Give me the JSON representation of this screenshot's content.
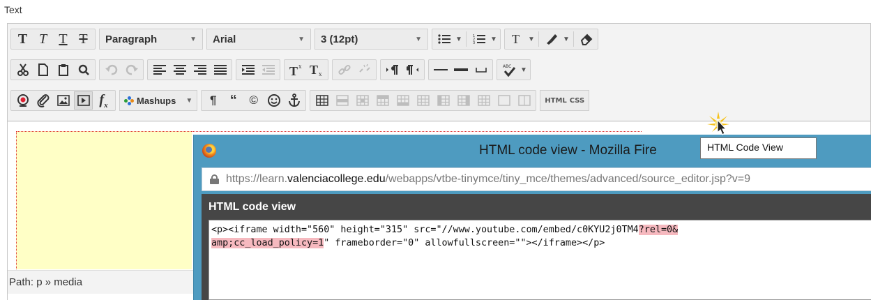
{
  "section_label": "Text",
  "toolbar": {
    "row1": {
      "format_buttons": [
        {
          "name": "bold-button",
          "glyph": "T"
        },
        {
          "name": "italic-button",
          "glyph": "T"
        },
        {
          "name": "underline-button",
          "glyph": "T"
        },
        {
          "name": "strikethrough-button",
          "glyph": "T"
        }
      ],
      "paragraph_select": "Paragraph",
      "font_select": "Arial",
      "size_select": "3 (12pt)"
    },
    "row3": {
      "mashups_label": "Mashups",
      "html_label": "HTML",
      "css_label": "CSS"
    }
  },
  "path_bar": {
    "label": "Path:",
    "value": "p » media"
  },
  "popup": {
    "title": "HTML code view - Mozilla Fire",
    "url_prefix": "https://learn.",
    "url_host": "valenciacollege.edu",
    "url_path": "/webapps/vtbe-tinymce/tiny_mce/themes/advanced/source_editor.jsp?v=9",
    "panel_title": "HTML code view",
    "code": {
      "line1_a": "<p><iframe width=\"560\" height=\"315\" src=\"//www.youtube.com/embed/c0KYU2j0TM4",
      "line1_hl": "?rel=0&",
      "line2_hl": "amp;cc_load_policy=1",
      "line2_b": "\" frameborder=\"0\" allowfullscreen=\"\"></iframe></p>"
    }
  },
  "tooltip": "HTML Code View",
  "colors": {
    "popup_titlebar": "#4e9bc0",
    "code_panel": "#464646",
    "highlight": "#f6b9bf",
    "editor_yellow": "#ffffc6"
  }
}
